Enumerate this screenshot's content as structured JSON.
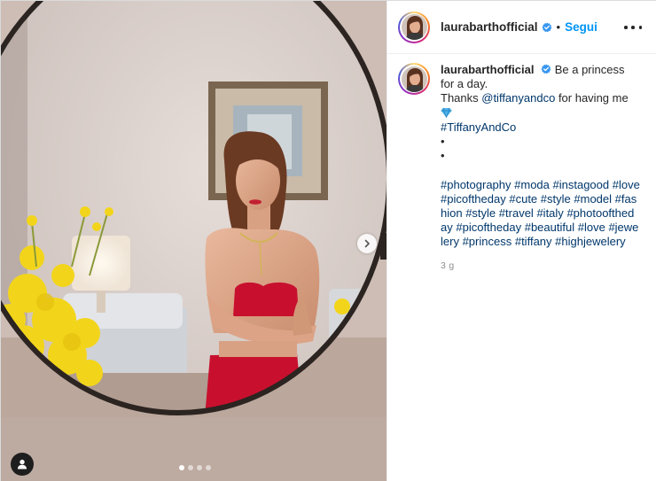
{
  "post": {
    "username": "laurabarthofficial",
    "verified_icon": "verified-badge-icon",
    "follow_label": "Segui",
    "separator": "•",
    "more_icon": "more-options-icon"
  },
  "carousel": {
    "slides_total": 4,
    "active_slide": 1,
    "next_icon": "chevron-right-icon",
    "tags_icon": "user-tag-icon"
  },
  "caption": {
    "username": "laurabarthofficial",
    "first_line": "Be a princess for a day.",
    "thanks_prefix": "Thanks ",
    "mention": "@tiffanyandco",
    "thanks_suffix": " for having me",
    "gem_icon": "gem-emoji-icon",
    "hashtag_brand": "#TiffanyAndCo",
    "bullet_1": "•",
    "bullet_2": "•",
    "hashtags": [
      "#photography",
      "#moda",
      "#instagood",
      "#love",
      "#picoftheday",
      "#cute",
      "#style",
      "#model",
      "#fashion",
      "#style",
      "#travel",
      "#italy",
      "#photooftheday",
      "#picoftheday",
      "#beautiful",
      "#love",
      "#jewelery",
      "#princess",
      "#tiffany",
      "#highjewelery"
    ],
    "time_ago": "3 g"
  },
  "colors": {
    "follow_blue": "#0095f6",
    "link_navy": "#00376b",
    "muted": "#8e8e8e",
    "dress_red": "#c8102e"
  }
}
